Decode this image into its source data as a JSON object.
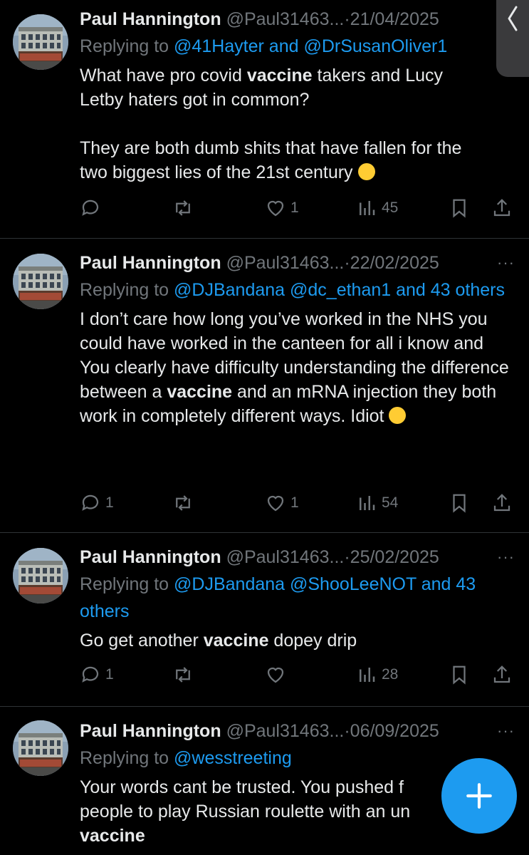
{
  "tweets": [
    {
      "name": "Paul Hannington",
      "handle": "@Paul31463...",
      "date": "21/04/2025",
      "more": "···",
      "reply_prefix": "Replying to ",
      "reply_links": "@41Hayter and @DrSusanOliver1",
      "text_1a": "What have pro covid ",
      "text_1b": "vaccine",
      "text_1c": " takers and Lucy Letby haters got in common?",
      "text_2": "They are both dumb shits that have fallen for the two biggest lies of the 21st century",
      "emoji": "wink-emoji",
      "replies": "",
      "reposts": "",
      "likes": "1",
      "views": "45"
    },
    {
      "name": "Paul Hannington",
      "handle": "@Paul31463...",
      "date": "22/02/2025",
      "more": "···",
      "reply_prefix": "Replying to ",
      "reply_links": "@DJBandana @dc_ethan1 and 43 others",
      "text_1a": "I don’t care how long you’ve worked in the NHS you could have worked in the canteen for all i know and You clearly have difficulty understanding the difference between a ",
      "text_1b": "vaccine",
      "text_1c": " and an mRNA injection they both work in completely different ways. Idiot",
      "emoji": "eye-roll-emoji",
      "replies": "1",
      "reposts": "",
      "likes": "1",
      "views": "54"
    },
    {
      "name": "Paul Hannington",
      "handle": "@Paul31463...",
      "date": "25/02/2025",
      "more": "···",
      "reply_prefix": "Replying to ",
      "reply_links": "@DJBandana @ShooLeeNOT and 43 others",
      "text_1a": "Go get another ",
      "text_1b": "vaccine",
      "text_1c": " dopey drip",
      "replies": "1",
      "reposts": "",
      "likes": "",
      "views": "28"
    },
    {
      "name": "Paul Hannington",
      "handle": "@Paul31463...",
      "date": "06/09/2025",
      "more": "···",
      "reply_prefix": "Replying to ",
      "reply_links": "@wesstreeting",
      "text_1a": "Your words cant be trusted. You pushed f",
      "text_1b": "",
      "text_1c": "",
      "text_2a": "people to play Russian roulette with an un",
      "text_3": "vaccine"
    }
  ],
  "colors": {
    "background": "#000000",
    "text": "#e7e9ea",
    "muted": "#71767b",
    "link": "#1d9bf0",
    "fab": "#1d9bf0"
  },
  "icons": {
    "reply": "reply-icon",
    "repost": "repost-icon",
    "like": "heart-icon",
    "views": "views-icon",
    "bookmark": "bookmark-icon",
    "share": "share-icon",
    "compose": "plus-icon"
  }
}
